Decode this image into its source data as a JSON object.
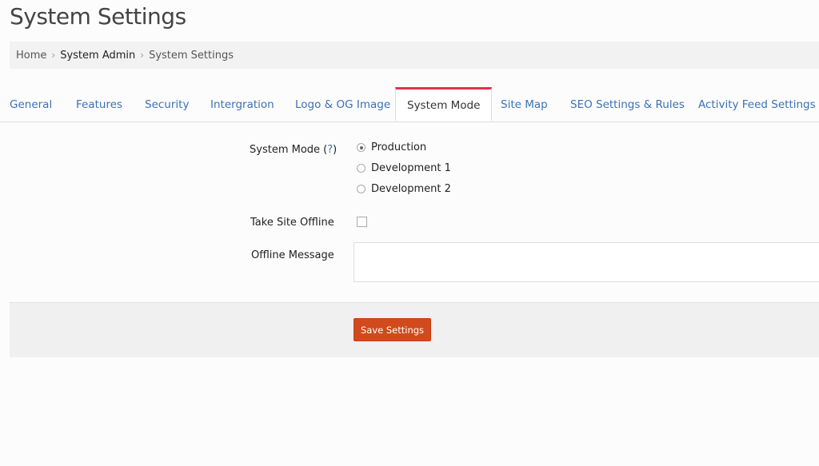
{
  "page": {
    "title": "System Settings"
  },
  "breadcrumb": {
    "items": [
      "Home",
      "System Admin",
      "System Settings"
    ],
    "separator": "›"
  },
  "tabs": [
    {
      "label": "General",
      "active": false
    },
    {
      "label": "Features",
      "active": false
    },
    {
      "label": "Security",
      "active": false
    },
    {
      "label": "Intergration",
      "active": false
    },
    {
      "label": "Logo & OG Image",
      "active": false
    },
    {
      "label": "System Mode",
      "active": true
    },
    {
      "label": "Site Map",
      "active": false
    },
    {
      "label": "SEO Settings & Rules",
      "active": false
    },
    {
      "label": "Activity Feed Settings",
      "active": false
    }
  ],
  "form": {
    "system_mode": {
      "label": "System Mode (",
      "help": "?",
      "label_end": ")",
      "options": [
        {
          "label": "Production",
          "checked": true
        },
        {
          "label": "Development 1",
          "checked": false
        },
        {
          "label": "Development 2",
          "checked": false
        }
      ]
    },
    "take_offline": {
      "label": "Take Site Offline",
      "checked": false
    },
    "offline_message": {
      "label": "Offline Message",
      "value": ""
    },
    "save_label": "Save Settings"
  },
  "colors": {
    "accent_tab": "#e0344a",
    "link": "#3a72b6",
    "save_button": "#d04a1c"
  }
}
